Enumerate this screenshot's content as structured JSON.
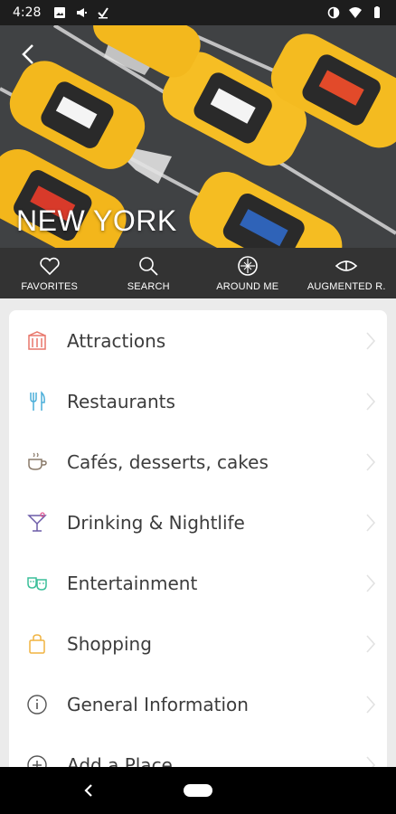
{
  "status_bar": {
    "time": "4:28",
    "left_icons": [
      "image-icon",
      "megaphone-icon",
      "download-icon"
    ],
    "right_icons": [
      "data-saver-icon",
      "wifi-icon",
      "battery-icon"
    ]
  },
  "hero": {
    "city_title": "NEW YORK",
    "back_icon": "chevron-left-icon"
  },
  "tabs": [
    {
      "label": "FAVORITES",
      "icon": "heart-icon"
    },
    {
      "label": "SEARCH",
      "icon": "search-icon"
    },
    {
      "label": "AROUND ME",
      "icon": "compass-icon"
    },
    {
      "label": "AUGMENTED R.",
      "icon": "eye-icon"
    }
  ],
  "menu": [
    {
      "label": "Attractions",
      "icon": "building-icon",
      "color": "#e8776b"
    },
    {
      "label": "Restaurants",
      "icon": "fork-knife-icon",
      "color": "#4aaed9"
    },
    {
      "label": "Cafés, desserts, cakes",
      "icon": "coffee-cup-icon",
      "color": "#8a7a6a"
    },
    {
      "label": "Drinking & Nightlife",
      "icon": "cocktail-icon",
      "color": "#6c5ca8"
    },
    {
      "label": "Entertainment",
      "icon": "theater-masks-icon",
      "color": "#3cbf9a"
    },
    {
      "label": "Shopping",
      "icon": "shopping-bag-icon",
      "color": "#f0b340"
    },
    {
      "label": "General Information",
      "icon": "info-icon",
      "color": "#555555"
    },
    {
      "label": "Add a Place",
      "icon": "plus-circle-icon",
      "color": "#555555"
    }
  ],
  "colors": {
    "tabbar_bg": "#333333",
    "status_bg": "#1d1d1d",
    "page_bg": "#ebebeb",
    "text": "#3c3c3c"
  }
}
